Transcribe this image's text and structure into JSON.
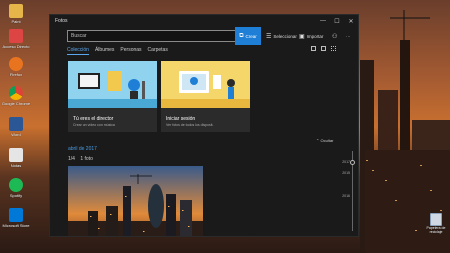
{
  "desktop": {
    "icons": [
      {
        "label": "Paint",
        "color": "#e5b54a"
      },
      {
        "label": "Acceso Directo",
        "color": "#d44"
      },
      {
        "label": "Firefox",
        "color": "#e8741f"
      },
      {
        "label": "Google Chrome",
        "color": "#3aa757"
      },
      {
        "label": "Word",
        "color": "#2b5797"
      },
      {
        "label": "Notas",
        "color": "#e5e5e5"
      },
      {
        "label": "Spotify",
        "color": "#1db954"
      },
      {
        "label": "Microsoft Store",
        "color": "#0078d7"
      }
    ],
    "recycle_label": "Papelera de reciclaje"
  },
  "window": {
    "title": "Fotos",
    "controls": {
      "minimize": "—",
      "maximize": "☐",
      "close": "✕"
    }
  },
  "toolbar": {
    "search_placeholder": "Buscar",
    "search_icon": "search-icon",
    "crear_label": "Crear",
    "seleccionar_label": "Seleccionar",
    "importar_label": "Importar",
    "more_label": "···"
  },
  "nav": {
    "tabs": [
      "Colección",
      "Álbumes",
      "Personas",
      "Carpetas"
    ],
    "active_index": 0
  },
  "cards": [
    {
      "title": "Tú eres el director",
      "subtitle": "Crear un vídeo con música",
      "accent": "#6bbce0"
    },
    {
      "title": "Iniciar sesión",
      "subtitle": "Ver fotos de todos los disposit.",
      "accent": "#f2c94c"
    }
  ],
  "dismiss_label": "Ocultar",
  "group": {
    "date": "abril de 2017",
    "selected": "1/4",
    "count": "1 foto"
  },
  "timeline": {
    "years": [
      "2017",
      "2015",
      "2016"
    ]
  },
  "colors": {
    "accent": "#1f7fd6",
    "link": "#4a9be0"
  }
}
